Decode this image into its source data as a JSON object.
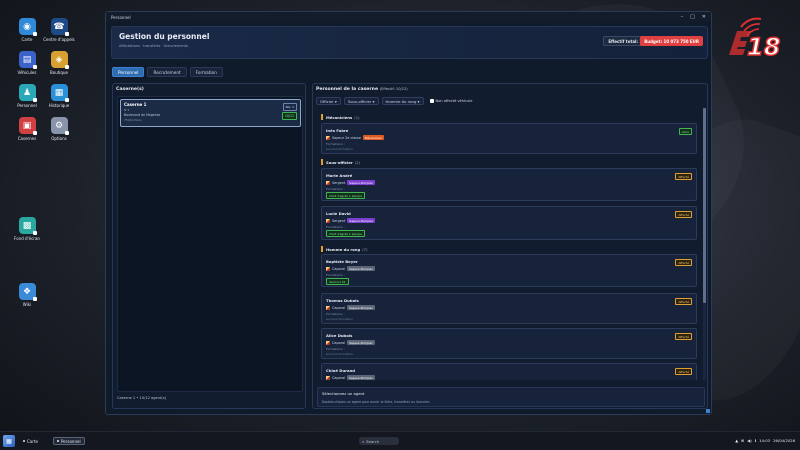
{
  "desktop": {
    "icons": [
      {
        "label": "Carte",
        "glyph": "◉",
        "color": "#2f8ad8"
      },
      {
        "label": "Centre d'appels",
        "glyph": "☎",
        "color": "#1e4a88"
      },
      {
        "label": "Véhicules",
        "glyph": "▤",
        "color": "#3a62c8"
      },
      {
        "label": "Boutique",
        "glyph": "◈",
        "color": "#d8a030"
      },
      {
        "label": "Personnel",
        "glyph": "♟",
        "color": "#2aa8b8"
      },
      {
        "label": "Historique",
        "glyph": "▦",
        "color": "#2a90d8"
      },
      {
        "label": "Casernes",
        "glyph": "▣",
        "color": "#d04040"
      },
      {
        "label": "Options",
        "glyph": "⚙",
        "color": "#8894aa"
      },
      {
        "label": "Fond d'écran",
        "glyph": "▩",
        "color": "#2aa8a0"
      },
      {
        "label": "Wiki",
        "glyph": "❖",
        "color": "#3a8ad8"
      }
    ]
  },
  "logo": {
    "text": "18",
    "color": "#e03030"
  },
  "window": {
    "title": "Personnel",
    "controls": [
      "–",
      "□",
      "✕"
    ],
    "header": {
      "title": "Gestion du personnel",
      "subtitle": "Affectations · transferts · licenciements",
      "effectif": "Effectif total: 10",
      "budget": "Budget: 10 073 750 EUR"
    },
    "tabs": [
      {
        "label": "Personnel",
        "active": true
      },
      {
        "label": "Recrutement",
        "active": false
      },
      {
        "label": "Formation",
        "active": false
      }
    ],
    "left": {
      "title": "Caserne(s)",
      "caserne": {
        "name": "Caserne 1",
        "id": "N°1",
        "address": "Boulevard de Magenta",
        "cp": "75010 Paris",
        "niveau": "Niv. 1",
        "count": "10/12"
      },
      "footer": "Caserne 1 • 10/12 agent(s)"
    },
    "right": {
      "title": "Personnel de la caserne",
      "count": "(Effectif: 10/12)",
      "filters": [
        "Officier ▾",
        "Sous-officier ▾",
        "Homme du rang ▾"
      ],
      "checkbox": "Non affecté véhicule",
      "sections": [
        {
          "title": "Mécaniciens",
          "count": "(1)"
        },
        {
          "title": "Sous-officier",
          "count": "(2)"
        },
        {
          "title": "Homme du rang",
          "count": "(7)"
        }
      ],
      "agents": [
        {
          "name": "Inès Fabre",
          "grade": "Sapeur 2e classe",
          "tag": "Mécanicien",
          "formations_label": "Formations :",
          "formations": "Aucune formation",
          "status": "Libre"
        },
        {
          "name": "Marie André",
          "grade": "Sergent",
          "tag": "Sapeur-Pompier",
          "formations_label": "Formations :",
          "formations": "Chef d'agrès 1 équipe",
          "status": "Affecté"
        },
        {
          "name": "Lucie David",
          "grade": "Sergent",
          "tag": "Sapeur-Pompier",
          "formations_label": "Formations :",
          "formations": "Chef d'agrès 1 équipe",
          "status": "Affecté"
        },
        {
          "name": "Baptiste Boyer",
          "grade": "Caporal",
          "tag": "Sapeur-Pompier",
          "formations_label": "Formations :",
          "formations": "Secours 01",
          "status": "Affecté"
        },
        {
          "name": "Thomas Dubois",
          "grade": "Caporal",
          "tag": "Sapeur-Pompier",
          "formations_label": "Formations :",
          "formations": "Aucune formation",
          "status": "Affecté"
        },
        {
          "name": "Alice Dubois",
          "grade": "Caporal",
          "tag": "Sapeur-Pompier",
          "formations_label": "Formations :",
          "formations": "Aucune formation",
          "status": "Affecté"
        },
        {
          "name": "Chloé Durand",
          "grade": "Caporal",
          "tag": "Sapeur-Pompier",
          "formations_label": "Formations :",
          "formations": "",
          "status": "Affecté"
        }
      ],
      "selection": {
        "title": "Sélectionnez un agent",
        "hint": "Double-cliquez un agent pour ouvrir la fiche, transférer ou licencier."
      }
    }
  },
  "taskbar": {
    "items": [
      {
        "label": "Carte",
        "active": false
      },
      {
        "label": "Personnel",
        "active": true
      }
    ],
    "search": "Search",
    "tray": [
      "▲",
      "⊞",
      "◀)",
      "ℹ"
    ],
    "time": "14:03",
    "date": "26/04/2026"
  }
}
